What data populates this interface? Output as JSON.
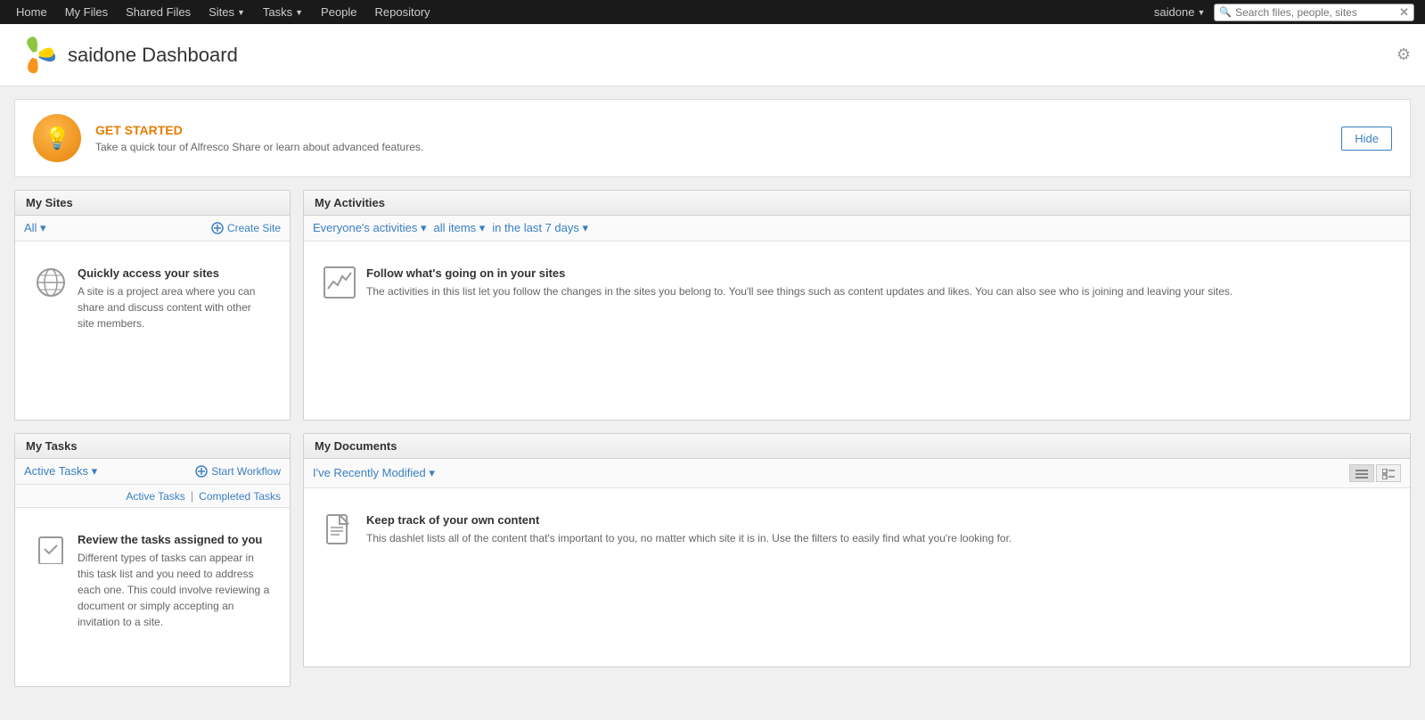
{
  "topnav": {
    "items": [
      {
        "label": "Home",
        "has_arrow": false
      },
      {
        "label": "My Files",
        "has_arrow": false
      },
      {
        "label": "Shared Files",
        "has_arrow": false
      },
      {
        "label": "Sites",
        "has_arrow": true
      },
      {
        "label": "Tasks",
        "has_arrow": true
      },
      {
        "label": "People",
        "has_arrow": false
      },
      {
        "label": "Repository",
        "has_arrow": false
      }
    ],
    "user": "saidone",
    "search_placeholder": "Search files, people, sites"
  },
  "header": {
    "title": "saidone Dashboard"
  },
  "get_started": {
    "title": "GET STARTED",
    "subtitle": "Take a quick tour of Alfresco Share or learn about advanced features.",
    "hide_label": "Hide"
  },
  "my_sites": {
    "header": "My Sites",
    "filter": "All ▾",
    "create_site": "Create Site",
    "empty_title": "Quickly access your sites",
    "empty_desc": "A site is a project area where you can share and discuss content with other site members."
  },
  "my_activities": {
    "header": "My Activities",
    "filter1": "Everyone's activities ▾",
    "filter2": "all items ▾",
    "filter3": "in the last 7 days ▾",
    "empty_title": "Follow what's going on in your sites",
    "empty_desc": "The activities in this list let you follow the changes in the sites you belong to. You'll see things such as content updates and likes. You can also see who is joining and leaving your sites."
  },
  "my_tasks": {
    "header": "My Tasks",
    "filter": "Active Tasks ▾",
    "start_workflow": "Start Workflow",
    "sub_link1": "Active Tasks",
    "sub_sep": "|",
    "sub_link2": "Completed Tasks",
    "empty_title": "Review the tasks assigned to you",
    "empty_desc": "Different types of tasks can appear in this task list and you need to address each one. This could involve reviewing a document or simply accepting an invitation to a site."
  },
  "my_documents": {
    "header": "My Documents",
    "filter": "I've Recently Modified ▾",
    "empty_title": "Keep track of your own content",
    "empty_desc": "This dashlet lists all of the content that's important to you, no matter which site it is in. Use the filters to easily find what you're looking for."
  },
  "colors": {
    "accent": "#3a7fc1",
    "orange": "#e67e00",
    "nav_bg": "#1a1a1a"
  }
}
